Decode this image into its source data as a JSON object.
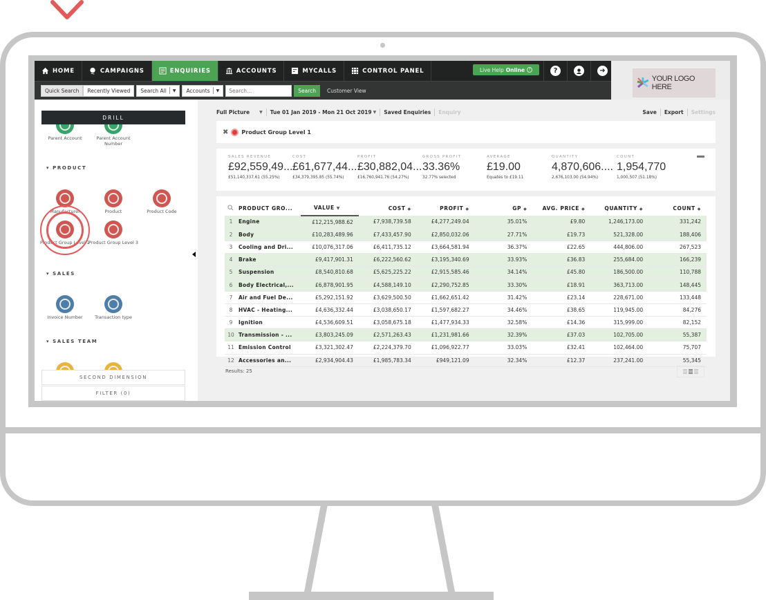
{
  "colors": {
    "nav_bg": "#212222",
    "accent_green": "#4da354",
    "highlight_row": "#e3efdf",
    "monitor_frame": "#c6c6c6",
    "pointer_red": "#e25a5a"
  },
  "nav": {
    "items": [
      {
        "label": "HOME",
        "icon": "home-icon",
        "active": false
      },
      {
        "label": "CAMPAIGNS",
        "icon": "campaigns-icon",
        "active": false
      },
      {
        "label": "ENQUIRIES",
        "icon": "enquiries-icon",
        "active": true
      },
      {
        "label": "ACCOUNTS",
        "icon": "bank-icon",
        "active": false
      },
      {
        "label": "MYCALLS",
        "icon": "calls-icon",
        "active": false
      },
      {
        "label": "CONTROL PANEL",
        "icon": "grid-icon",
        "active": false
      }
    ],
    "live_help": {
      "prefix": "Live Help",
      "status": "Online",
      "icon": "?"
    },
    "icons": [
      "help-icon",
      "user-icon",
      "logout-icon"
    ]
  },
  "subnav": {
    "quick_search": "Quick Search",
    "recently_viewed": "Recently Viewed",
    "search_all": "Search All",
    "accounts": "Accounts",
    "search_placeholder": "Search...",
    "search_button": "Search",
    "customer_view": "Customer View"
  },
  "logo": {
    "text": "YOUR LOGO HERE"
  },
  "sidebar": {
    "drill_label": "DRILL",
    "top_nodes": [
      {
        "label": "Parent Account",
        "color": "green"
      },
      {
        "label": "Parent Account Number",
        "color": "green"
      }
    ],
    "sections": [
      {
        "title": "PRODUCT",
        "nodes": [
          {
            "label": "Manufacturer"
          },
          {
            "label": "Product"
          },
          {
            "label": "Product Code"
          },
          {
            "label": "Product Group Level 2"
          },
          {
            "label": "Product Group Level 3"
          }
        ]
      },
      {
        "title": "SALES",
        "nodes": [
          {
            "label": "Invoice Number"
          },
          {
            "label": "Transaction type"
          }
        ]
      },
      {
        "title": "SALES TEAM",
        "nodes": []
      }
    ],
    "second_dimension": "SECOND DIMENSION",
    "filter": "FILTER (0)"
  },
  "toolbar": {
    "view": "Full Picture",
    "date_range": "Tue 01 Jan 2019 - Mon 21 Oct 2019",
    "saved_enquiries": "Saved Enquiries",
    "enquiry": "Enquiry",
    "save": "Save",
    "export": "Export",
    "settings": "Settings"
  },
  "chip": {
    "label": "Product Group Level 1"
  },
  "kpis": [
    {
      "label": "SALES REVENUE",
      "value": "£92,559,49...",
      "sub": "£51,140,337.61 (55.25%)"
    },
    {
      "label": "COST",
      "value": "£61,677,44...",
      "sub": "£34,379,395.85 (55.74%)"
    },
    {
      "label": "PROFIT",
      "value": "£30,882,04...",
      "sub": "£16,760,941.76 (54.27%)"
    },
    {
      "label": "GROSS PROFIT",
      "value": "33.36%",
      "sub": "32.77% selected"
    },
    {
      "label": "AVERAGE",
      "value": "£19.00",
      "sub": "Equates to £19.11"
    },
    {
      "label": "QUANTITY",
      "value": "4,870,606....",
      "sub": "2,676,103.00 (54.94%)"
    },
    {
      "label": "COUNT",
      "value": "1,954,770",
      "sub": "1,000,507 (51.18%)"
    }
  ],
  "table": {
    "columns": [
      "PRODUCT GRO...",
      "VALUE",
      "COST",
      "PROFIT",
      "GP",
      "AVG. PRICE",
      "QUANTITY",
      "COUNT"
    ],
    "rows": [
      {
        "n": "1",
        "name": "Engine",
        "value": "£12,215,988.62",
        "cost": "£7,938,739.58",
        "profit": "£4,277,249.04",
        "gp": "35.01%",
        "avg": "£9.80",
        "qty": "1,246,173.00",
        "count": "331,242",
        "highlighted": true
      },
      {
        "n": "2",
        "name": "Body",
        "value": "£10,283,489.96",
        "cost": "£7,433,457.90",
        "profit": "£2,850,032.06",
        "gp": "27.71%",
        "avg": "£19.73",
        "qty": "521,328.00",
        "count": "188,406",
        "highlighted": true
      },
      {
        "n": "3",
        "name": "Cooling and Dri...",
        "value": "£10,076,317.06",
        "cost": "£6,411,735.12",
        "profit": "£3,664,581.94",
        "gp": "36.37%",
        "avg": "£22.65",
        "qty": "444,806.00",
        "count": "267,523",
        "highlighted": false
      },
      {
        "n": "4",
        "name": "Brake",
        "value": "£9,417,901.31",
        "cost": "£6,222,560.62",
        "profit": "£3,195,340.69",
        "gp": "33.93%",
        "avg": "£36.83",
        "qty": "255,684.00",
        "count": "166,239",
        "highlighted": true
      },
      {
        "n": "5",
        "name": "Suspension",
        "value": "£8,540,810.68",
        "cost": "£5,625,225.22",
        "profit": "£2,915,585.46",
        "gp": "34.14%",
        "avg": "£45.80",
        "qty": "186,500.00",
        "count": "110,788",
        "highlighted": true
      },
      {
        "n": "6",
        "name": "Body Electrical,...",
        "value": "£6,878,901.95",
        "cost": "£4,588,149.10",
        "profit": "£2,290,752.85",
        "gp": "33.30%",
        "avg": "£18.91",
        "qty": "363,713.00",
        "count": "148,445",
        "highlighted": true
      },
      {
        "n": "7",
        "name": "Air and Fuel De...",
        "value": "£5,292,151.92",
        "cost": "£3,629,500.50",
        "profit": "£1,662,651.42",
        "gp": "31.42%",
        "avg": "£23.14",
        "qty": "228,671.00",
        "count": "133,448",
        "highlighted": false
      },
      {
        "n": "8",
        "name": "HVAC - Heating...",
        "value": "£4,636,332.44",
        "cost": "£3,038,650.17",
        "profit": "£1,597,682.27",
        "gp": "34.46%",
        "avg": "£38.65",
        "qty": "119,945.00",
        "count": "84,276",
        "highlighted": false
      },
      {
        "n": "9",
        "name": "Ignition",
        "value": "£4,536,609.51",
        "cost": "£3,058,675.18",
        "profit": "£1,477,934.33",
        "gp": "32.58%",
        "avg": "£14.36",
        "qty": "315,999.00",
        "count": "82,152",
        "highlighted": false
      },
      {
        "n": "10",
        "name": "Transmission - ...",
        "value": "£3,803,245.09",
        "cost": "£2,571,263.43",
        "profit": "£1,231,981.66",
        "gp": "32.39%",
        "avg": "£37.03",
        "qty": "102,705.00",
        "count": "55,387",
        "highlighted": true
      },
      {
        "n": "11",
        "name": "Emission Control",
        "value": "£3,321,302.47",
        "cost": "£2,224,379.70",
        "profit": "£1,096,922.77",
        "gp": "33.03%",
        "avg": "£32.41",
        "qty": "102,464.00",
        "count": "75,707",
        "highlighted": false
      },
      {
        "n": "12",
        "name": "Accessories an...",
        "value": "£2,934,904.43",
        "cost": "£1,985,783.34",
        "profit": "£949,121.09",
        "gp": "32.34%",
        "avg": "£12.37",
        "qty": "237,241.00",
        "count": "55,345",
        "highlighted": false
      }
    ],
    "results_label": "Results: 25"
  }
}
